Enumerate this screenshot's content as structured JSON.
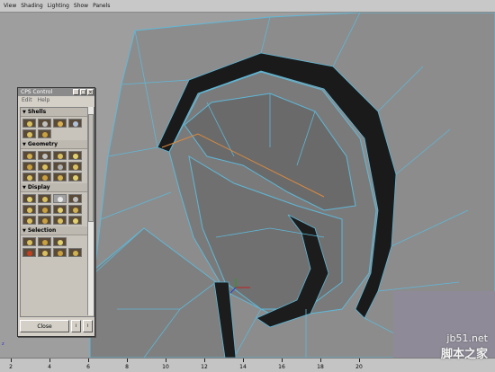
{
  "menu": [
    "View",
    "Shading",
    "Lighting",
    "Show",
    "Panels"
  ],
  "panel": {
    "title": "CPS Control",
    "menu": [
      "Edit",
      "Help"
    ],
    "sections": [
      {
        "label": "Shells"
      },
      {
        "label": "Geometry"
      },
      {
        "label": "Display"
      },
      {
        "label": "Selection"
      }
    ],
    "close_label": "Close"
  },
  "axis_label": "z",
  "timeline": {
    "labels": [
      "2",
      "4",
      "6",
      "8",
      "10",
      "12",
      "14",
      "16",
      "18",
      "20"
    ]
  },
  "watermark": {
    "line1": "jb51.net",
    "line2": "脚本之家"
  },
  "colors": {
    "wire": "#5fb8d8",
    "mesh": "#8a8a8a",
    "viewport": "#9e9e9e"
  }
}
